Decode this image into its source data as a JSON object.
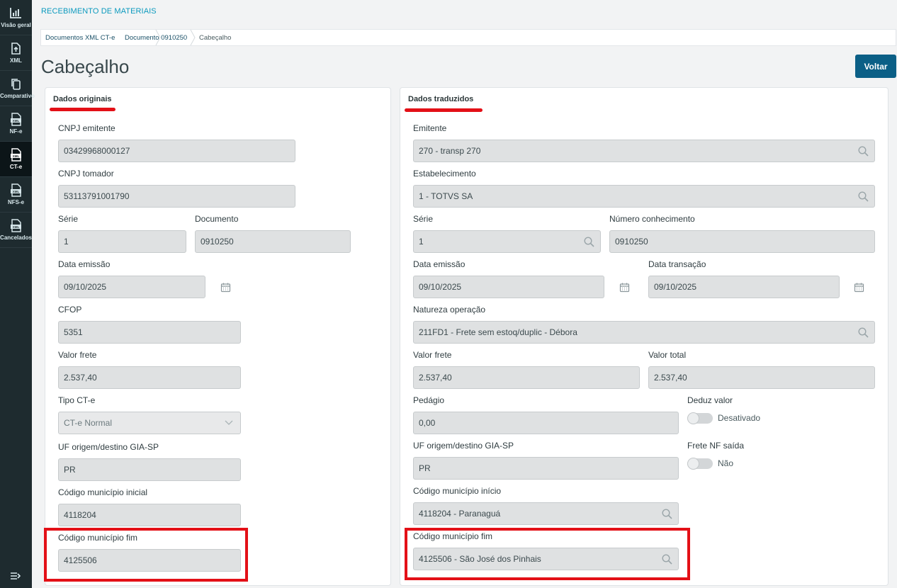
{
  "sidebar": {
    "items": [
      {
        "label": "Visão geral",
        "icon": "chart-icon"
      },
      {
        "label": "XML",
        "icon": "file-upload-icon"
      },
      {
        "label": "Comparativo",
        "icon": "copy-icon"
      },
      {
        "label": "NF-e",
        "icon": "xml-file-icon"
      },
      {
        "label": "CT-e",
        "icon": "xml-file-icon"
      },
      {
        "label": "NFS-e",
        "icon": "xml-file-icon"
      },
      {
        "label": "Cancelados",
        "icon": "xml-file-icon"
      }
    ],
    "active": "CT-e",
    "collapse_icon": "collapse-menu-icon"
  },
  "header": {
    "app_title": "RECEBIMENTO DE MATERIAIS",
    "breadcrumb": [
      "Documentos XML CT-e",
      "Documento 0910250",
      "Cabeçalho"
    ],
    "page_title": "Cabeçalho",
    "back_button": "Voltar"
  },
  "original": {
    "title": "Dados originais",
    "cnpj_emitente_label": "CNPJ emitente",
    "cnpj_emitente": "03429968000127",
    "cnpj_tomador_label": "CNPJ tomador",
    "cnpj_tomador": "53113791001790",
    "serie_label": "Série",
    "serie": "1",
    "documento_label": "Documento",
    "documento": "0910250",
    "data_emissao_label": "Data emissão",
    "data_emissao": "09/10/2025",
    "cfop_label": "CFOP",
    "cfop": "5351",
    "valor_frete_label": "Valor frete",
    "valor_frete": "2.537,40",
    "tipo_cte_label": "Tipo CT-e",
    "tipo_cte": "CT-e Normal",
    "uf_label": "UF origem/destino GIA-SP",
    "uf": "PR",
    "mun_inicial_label": "Código município inicial",
    "mun_inicial": "4118204",
    "mun_fim_label": "Código município fim",
    "mun_fim": "4125506"
  },
  "translated": {
    "title": "Dados traduzidos",
    "emitente_label": "Emitente",
    "emitente": "270 - transp 270",
    "estabelecimento_label": "Estabelecimento",
    "estabelecimento": "1 - TOTVS SA",
    "serie_label": "Série",
    "serie": "1",
    "numero_label": "Número conhecimento",
    "numero": "0910250",
    "data_emissao_label": "Data emissão",
    "data_emissao": "09/10/2025",
    "data_transacao_label": "Data transação",
    "data_transacao": "09/10/2025",
    "natureza_label": "Natureza operação",
    "natureza": "211FD1 - Frete sem estoq/duplic - Débora",
    "valor_frete_label": "Valor frete",
    "valor_frete": "2.537,40",
    "valor_total_label": "Valor total",
    "valor_total": "2.537,40",
    "pedagio_label": "Pedágio",
    "pedagio": "0,00",
    "deduz_label": "Deduz valor",
    "deduz_state": "Desativado",
    "uf_label": "UF origem/destino GIA-SP",
    "uf": "PR",
    "frete_nf_label": "Frete NF saída",
    "frete_nf_state": "Não",
    "mun_inicio_label": "Código município início",
    "mun_inicio": "4118204 - Paranaguá",
    "mun_fim_label": "Código município fim",
    "mun_fim": "4125506 - São José dos Pinhais"
  },
  "colors": {
    "sidebar_bg": "#1e2b2f",
    "accent": "#0c9abe",
    "button": "#0b5f86",
    "highlight": "#e31017",
    "input_bg": "#dfe1e2"
  }
}
